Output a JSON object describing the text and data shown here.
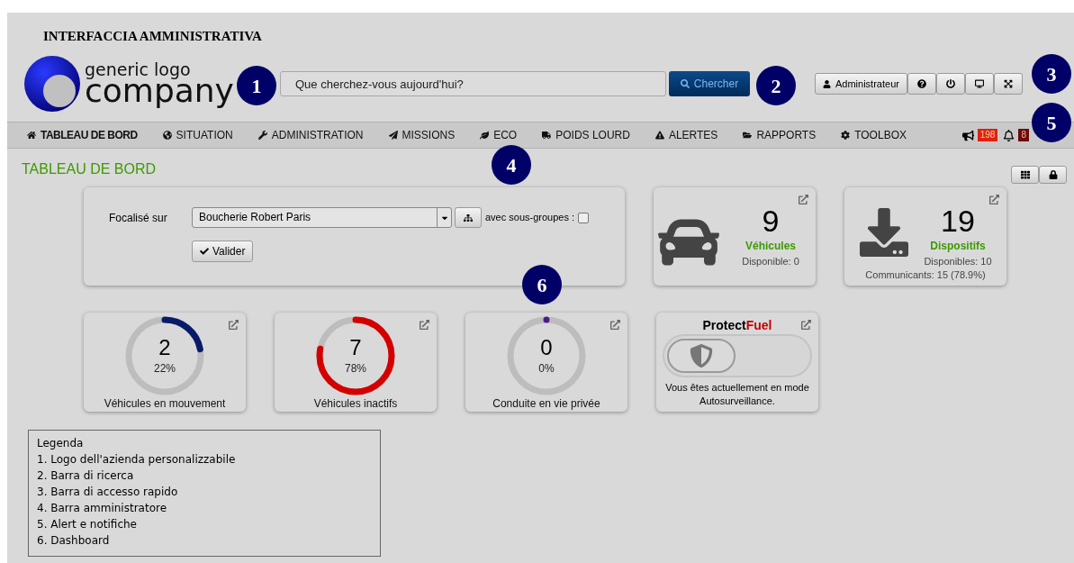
{
  "document_title": "INTERFACCIA AMMINISTRATIVA",
  "logo": {
    "line1": "generic logo",
    "line2": "company"
  },
  "search": {
    "placeholder": "Que cherchez-vous aujourd'hui?",
    "button": "Chercher"
  },
  "quick_access": {
    "user": "Administrateur"
  },
  "nav": {
    "items": [
      {
        "label": "TABLEAU DE BORD",
        "selected": true
      },
      {
        "label": "SITUATION",
        "selected": false
      },
      {
        "label": "ADMINISTRATION",
        "selected": false
      },
      {
        "label": "MISSIONS",
        "selected": false
      },
      {
        "label": "ECO",
        "selected": false
      },
      {
        "label": "POIDS LOURD",
        "selected": false
      },
      {
        "label": "ALERTES",
        "selected": false
      },
      {
        "label": "RAPPORTS",
        "selected": false
      },
      {
        "label": "TOOLBOX",
        "selected": false
      }
    ],
    "badges": [
      {
        "count": "198",
        "color": "#e02010"
      },
      {
        "count": "8",
        "color": "#6a0a0a"
      }
    ]
  },
  "page_title": "TABLEAU DE BORD",
  "focus": {
    "label": "Focalisé sur",
    "value": "Boucherie Robert Paris",
    "subgroups_label": "avec sous-groupes :",
    "subgroups_checked": false,
    "button": "Valider"
  },
  "stats": [
    {
      "number": "9",
      "title": "Véhicules",
      "lines": [
        "Disponible: 0"
      ]
    },
    {
      "number": "19",
      "title": "Dispositifs",
      "lines": [
        "Disponibles: 10",
        "Communicants: 15 (78.9%)"
      ]
    }
  ],
  "gauges": [
    {
      "number": "2",
      "percent": "22%",
      "label": "Véhicules en mouvement",
      "level": 0.22,
      "color": "#0a1a6a"
    },
    {
      "number": "7",
      "percent": "78%",
      "label": "Véhicules inactifs",
      "level": 0.78,
      "color": "#d40000"
    },
    {
      "number": "0",
      "percent": "0%",
      "label": "Conduite en vie privée",
      "level": 0,
      "color": "#4b1a8a"
    }
  ],
  "protect_fuel": {
    "title_dark": "Protect",
    "title_accent": "Fuel",
    "on": false,
    "message": "Vous êtes actuellement en mode Autosurveillance."
  },
  "callouts": [
    "1",
    "2",
    "3",
    "4",
    "5",
    "6"
  ],
  "legend": {
    "title": "Legenda",
    "items": [
      "1. Logo dell'azienda personalizzabile",
      "2. Barra di ricerca",
      "3. Barra di accesso rapido",
      "4. Barra amministratore",
      "5. Alert e notifiche",
      "6. Dashboard"
    ]
  }
}
